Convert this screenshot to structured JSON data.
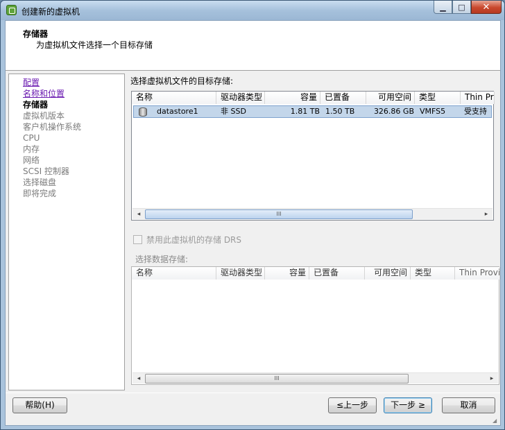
{
  "window": {
    "title": "创建新的虚拟机",
    "minimize": "▁",
    "maximize": "□",
    "close": "✕"
  },
  "header": {
    "title": "存储器",
    "subtitle": "为虚拟机文件选择一个目标存储"
  },
  "steps": [
    {
      "label": "配置",
      "state": "link"
    },
    {
      "label": "名称和位置",
      "state": "link"
    },
    {
      "label": "存储器",
      "state": "current"
    },
    {
      "label": "虚拟机版本",
      "state": "disabled"
    },
    {
      "label": "客户机操作系统",
      "state": "disabled"
    },
    {
      "label": "CPU",
      "state": "disabled"
    },
    {
      "label": "内存",
      "state": "disabled"
    },
    {
      "label": "网络",
      "state": "disabled"
    },
    {
      "label": "SCSI 控制器",
      "state": "disabled"
    },
    {
      "label": "选择磁盘",
      "state": "disabled"
    },
    {
      "label": "即将完成",
      "state": "disabled"
    }
  ],
  "target": {
    "label": "选择虚拟机文件的目标存储:",
    "columns": [
      "名称",
      "驱动器类型",
      "容量",
      "已置备",
      "可用空间",
      "类型",
      "Thin Prov"
    ],
    "rows": [
      {
        "name": "datastore1",
        "drive_type": "非 SSD",
        "capacity": "1.81 TB",
        "provisioned": "1.50 TB",
        "free": "326.86 GB",
        "type": "VMFS5",
        "thin": "受支持"
      }
    ]
  },
  "drs_checkbox": {
    "label": "禁用此虚拟机的存储 DRS",
    "checked": false,
    "enabled": false
  },
  "datastore": {
    "label": "选择数据存储:",
    "columns": [
      "名称",
      "驱动器类型",
      "容量",
      "已置备",
      "可用空间",
      "类型",
      "Thin Provi"
    ]
  },
  "scrollbar": {
    "left_arrow": "◂",
    "right_arrow": "▸",
    "grip": "III"
  },
  "buttons": {
    "help": "帮助(H)",
    "back": "≤上一步",
    "next": "下一步 ≥",
    "cancel": "取消"
  }
}
